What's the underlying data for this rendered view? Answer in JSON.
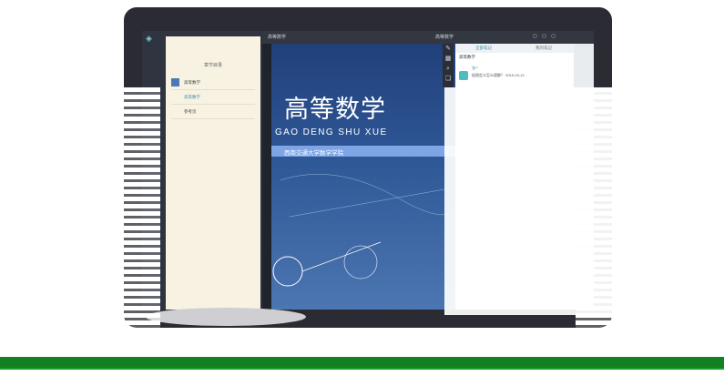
{
  "app": {
    "topbar_title": "高等数学",
    "topbar_book": "高等数学",
    "window_buttons": "▢ ▢ ▢"
  },
  "toc": {
    "title": "章节目录",
    "items": [
      {
        "label": "高等数学",
        "active": false
      },
      {
        "label": "高等数学",
        "active": true
      },
      {
        "label": "参考页",
        "active": false
      }
    ]
  },
  "toolbar": {
    "tools": [
      {
        "icon": "pen-icon",
        "glyph": "✎"
      },
      {
        "icon": "grid-icon",
        "glyph": "▦"
      },
      {
        "icon": "search-icon",
        "glyph": "⌕"
      },
      {
        "icon": "bookmark-icon",
        "glyph": "❏"
      }
    ]
  },
  "cover": {
    "title": "高等数学",
    "pinyin": "GAO DENG SHU XUE",
    "publisher": "西南交通大学数学学院",
    "logo_glyph": "❀"
  },
  "notes": {
    "tabs": [
      "全部笔记",
      "我的笔记"
    ],
    "header": "高等数学",
    "items": [
      {
        "user": "张**",
        "text": "极限定义怎么理解？ 2019-03-12"
      }
    ]
  },
  "colors": {
    "cover_top": "#21407a",
    "cover_bottom": "#4c76b1",
    "accent": "#3c8fb0",
    "floor": "#138022"
  }
}
